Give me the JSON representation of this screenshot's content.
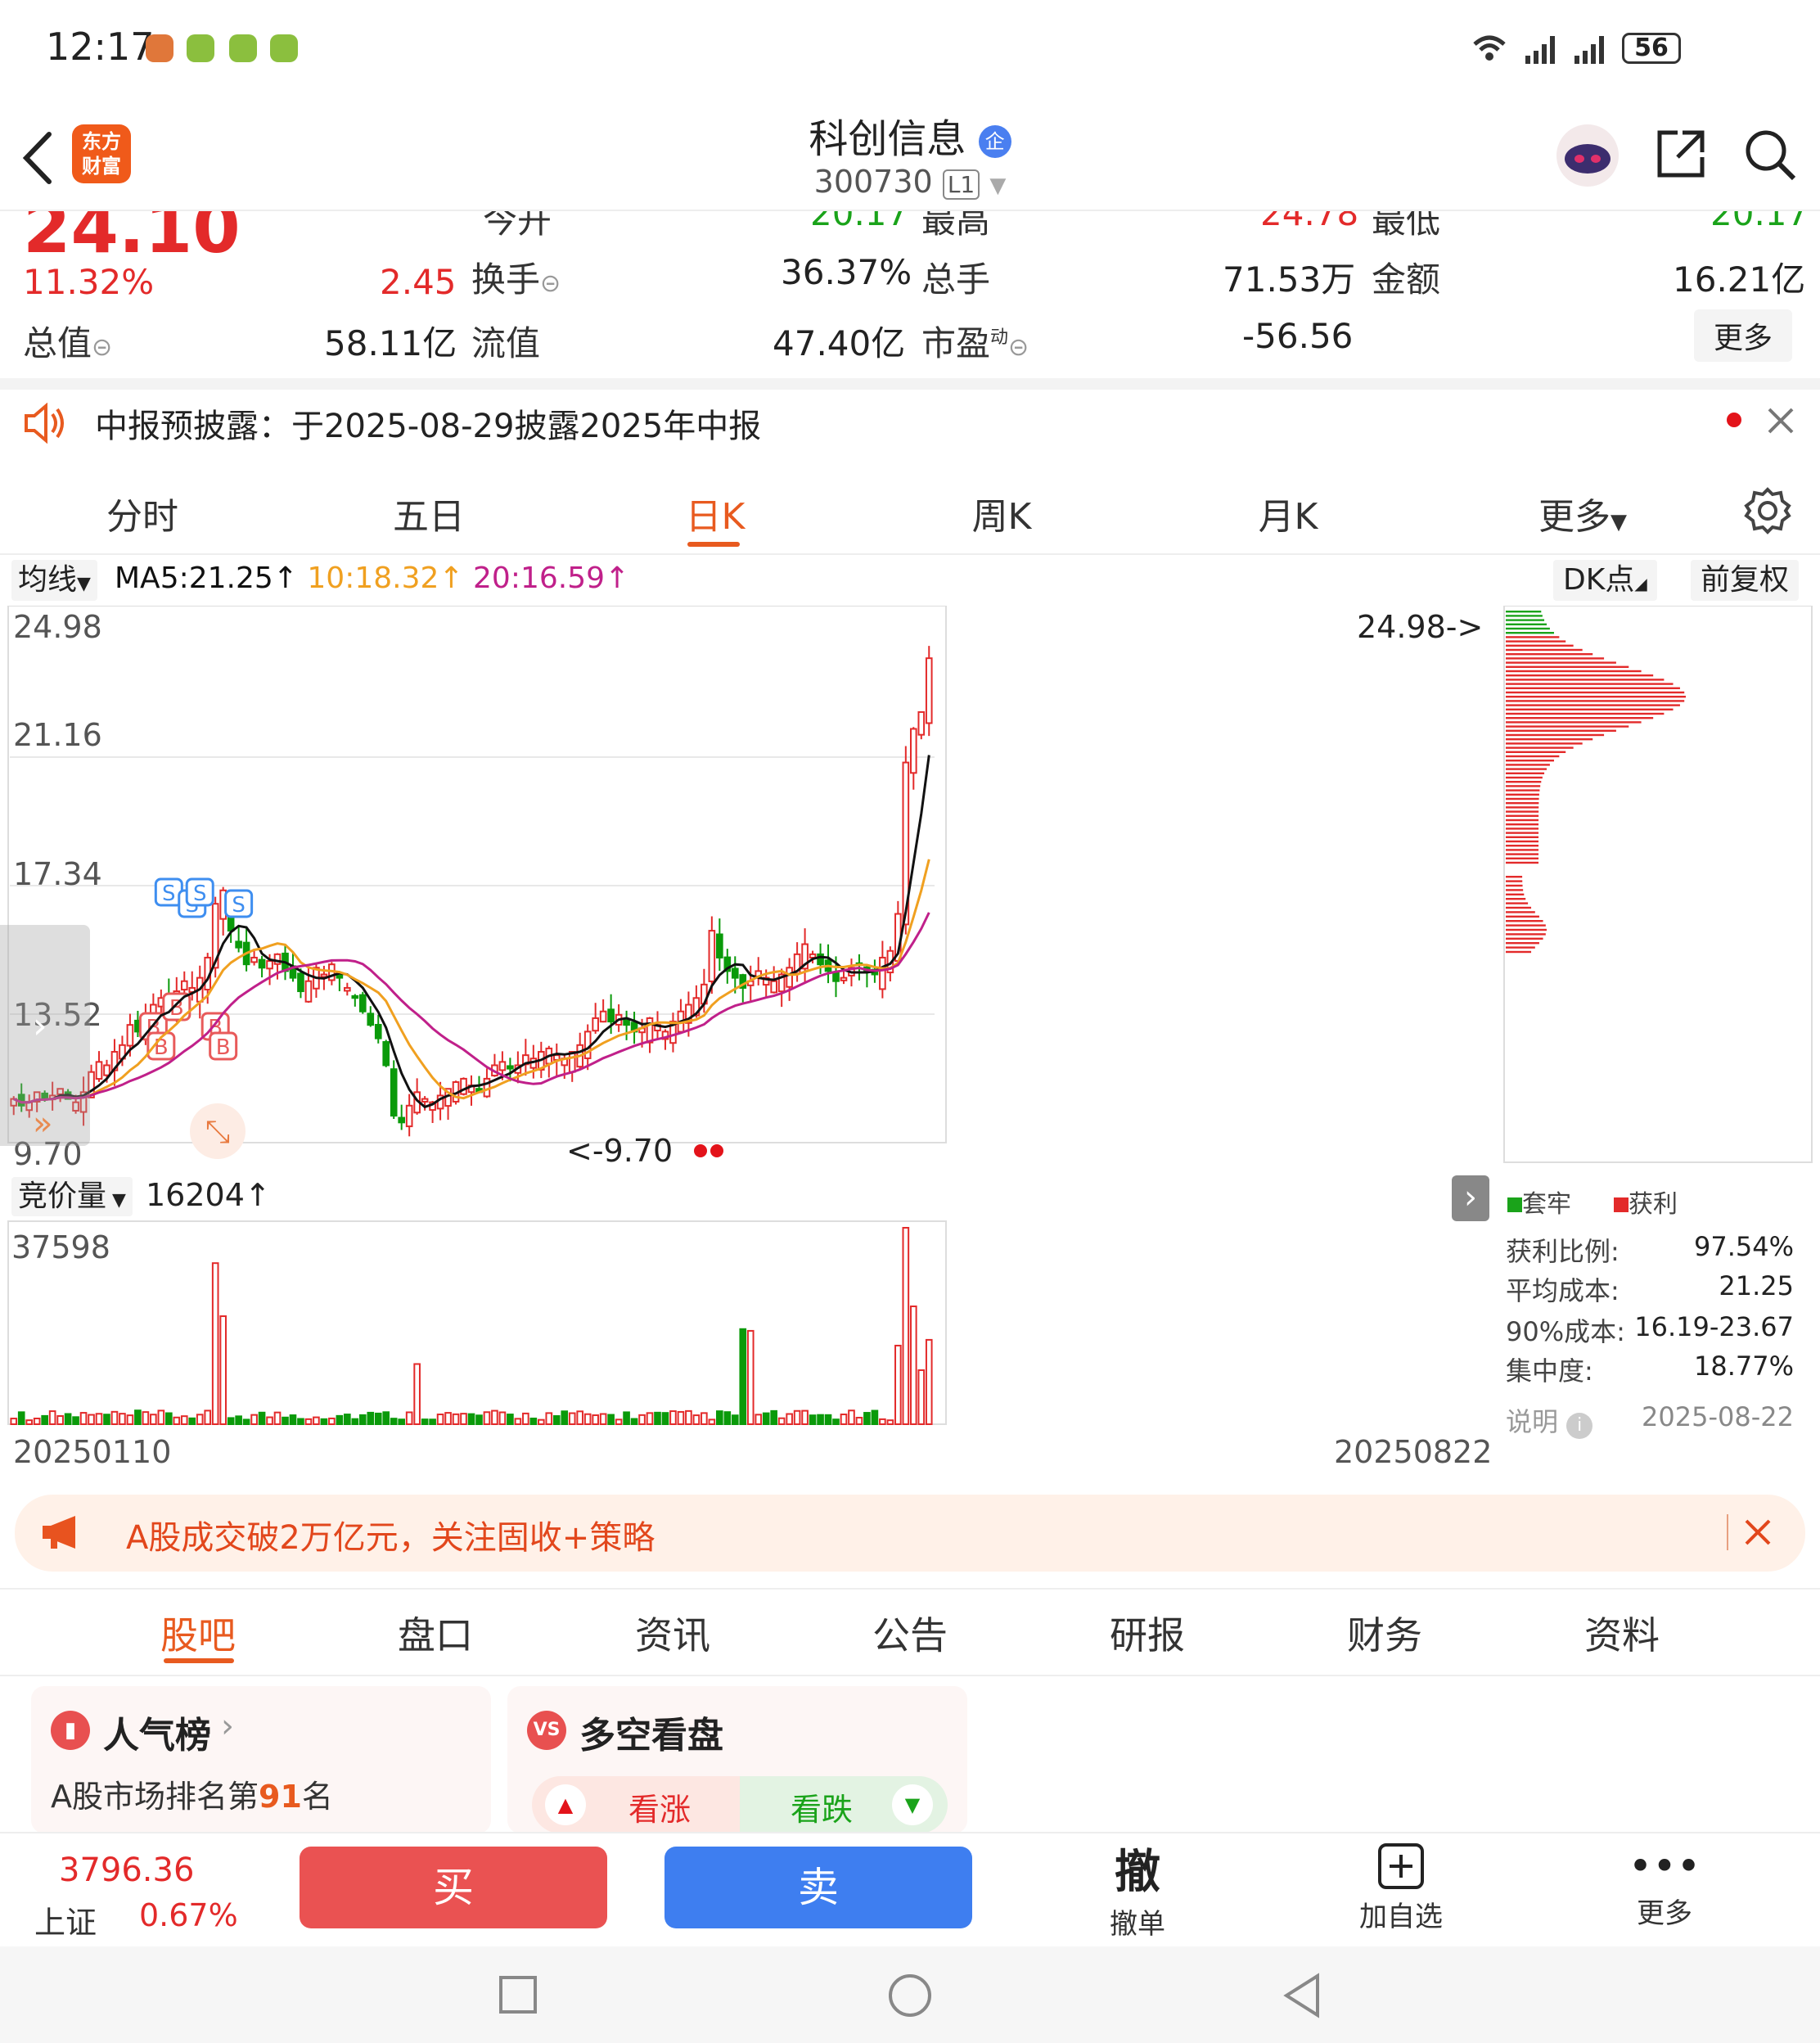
{
  "status_bar": {
    "time": "12:17",
    "battery": "56"
  },
  "header": {
    "app_logo_text": "东方\n财富",
    "stock_name": "科创信息",
    "verified_badge": "企",
    "stock_code": "300730",
    "level_badge": "L1"
  },
  "quote": {
    "price": "24.10",
    "top_cut": [
      "今开",
      "20.17",
      "最高",
      "24.78",
      "最低",
      "20.17"
    ],
    "change_pct": "11.32%",
    "change": "2.45",
    "turnover_label": "换手",
    "turnover": "36.37%",
    "volume_label": "总手",
    "volume": "71.53万",
    "amount_label": "金额",
    "amount": "16.21亿",
    "total_value_label": "总值",
    "total_value": "58.11亿",
    "float_value_label": "流值",
    "float_value": "47.40亿",
    "pe_label": "市盈",
    "pe_sup": "动",
    "pe": "-56.56",
    "more": "更多"
  },
  "notice": {
    "text": "中报预披露：于2025-08-29披露2025年中报"
  },
  "kline_tabs": [
    "分时",
    "五日",
    "日K",
    "周K",
    "月K",
    "更多"
  ],
  "active_kline_tab": "日K",
  "ma_bar": {
    "selector": "均线",
    "ma5": "MA5:21.25↑",
    "ma10": "10:18.32↑",
    "ma20": "20:16.59↑",
    "dk": "DK点",
    "adjust": "前复权",
    "colors": {
      "ma5": "#111111",
      "ma10": "#f0a020",
      "ma20": "#c0208a"
    }
  },
  "chart": {
    "y_labels": [
      "24.98",
      "21.16",
      "17.34",
      "13.52",
      "9.70"
    ],
    "high_marker": "24.98->",
    "low_marker": "<-9.70",
    "vol_selector": "竞价量",
    "vol_value": "16204↑",
    "vol_max": "37598",
    "date_start": "20250110",
    "date_end": "20250822",
    "legend_trapped": "套牢",
    "legend_profit": "获利",
    "signal_buy": "B",
    "signal_sell": "S",
    "colors": {
      "up": "#e32a2a",
      "down": "#0a9a0a"
    }
  },
  "chart_data": {
    "type": "candlestick",
    "x_range": [
      "20250110",
      "20250822"
    ],
    "ylim": [
      9.7,
      24.98
    ],
    "closes": [
      11.0,
      10.8,
      10.9,
      11.2,
      11.0,
      11.1,
      11.3,
      11.0,
      10.9,
      11.2,
      11.8,
      12.1,
      12.0,
      12.4,
      12.6,
      13.2,
      13.0,
      13.4,
      13.8,
      14.0,
      13.7,
      14.2,
      14.5,
      14.3,
      14.6,
      15.2,
      16.8,
      17.2,
      16.0,
      15.5,
      15.0,
      15.2,
      14.9,
      15.1,
      15.3,
      14.8,
      14.6,
      14.2,
      14.5,
      14.9,
      14.7,
      15.0,
      14.6,
      14.3,
      14.0,
      13.6,
      13.2,
      12.8,
      12.0,
      10.5,
      10.3,
      10.8,
      11.2,
      11.0,
      10.9,
      11.1,
      11.3,
      11.5,
      11.6,
      11.4,
      11.2,
      11.6,
      12.0,
      12.1,
      11.9,
      12.0,
      12.3,
      12.2,
      12.4,
      12.5,
      12.3,
      12.2,
      12.4,
      12.6,
      13.0,
      13.4,
      13.6,
      13.3,
      13.5,
      13.2,
      13.0,
      13.1,
      13.4,
      13.2,
      13.0,
      13.3,
      13.6,
      13.8,
      14.0,
      14.4,
      16.0,
      15.2,
      14.8,
      14.6,
      14.3,
      14.5,
      14.8,
      14.6,
      14.5,
      14.7,
      14.9,
      15.3,
      15.6,
      15.3,
      15.0,
      14.8,
      14.5,
      14.6,
      14.9,
      15.0,
      14.8,
      14.7,
      15.2,
      15.4,
      16.5,
      21.0,
      22.0,
      22.5,
      24.1
    ],
    "volume_max": 37598
  },
  "chip_stats": {
    "profit_ratio_label": "获利比例:",
    "profit_ratio": "97.54%",
    "avg_cost_label": "平均成本:",
    "avg_cost": "21.25",
    "cost90_label": "90%成本:",
    "cost90": "16.19-23.67",
    "concentration_label": "集中度:",
    "concentration": "18.77%",
    "explain_label": "说明",
    "date": "2025-08-22"
  },
  "banner": {
    "text": "A股成交破2万亿元，关注固收+策略"
  },
  "bottom_tabs": [
    "股吧",
    "盘口",
    "资讯",
    "公告",
    "研报",
    "财务",
    "资料"
  ],
  "cards": {
    "popularity_title": "人气榜",
    "popularity_rank_prefix": "A股市场排名第",
    "popularity_rank": "91",
    "popularity_rank_suffix": "名",
    "bullbear_title": "多空看盘",
    "bull_label": "看涨",
    "bear_label": "看跌"
  },
  "trade_bar": {
    "index_value": "3796.36",
    "index_name": "上证",
    "index_change": "0.67%",
    "buy": "买",
    "sell": "卖",
    "cancel_icon_text": "撤",
    "cancel_label": "撤单",
    "add_label": "加自选",
    "more_label": "更多"
  }
}
